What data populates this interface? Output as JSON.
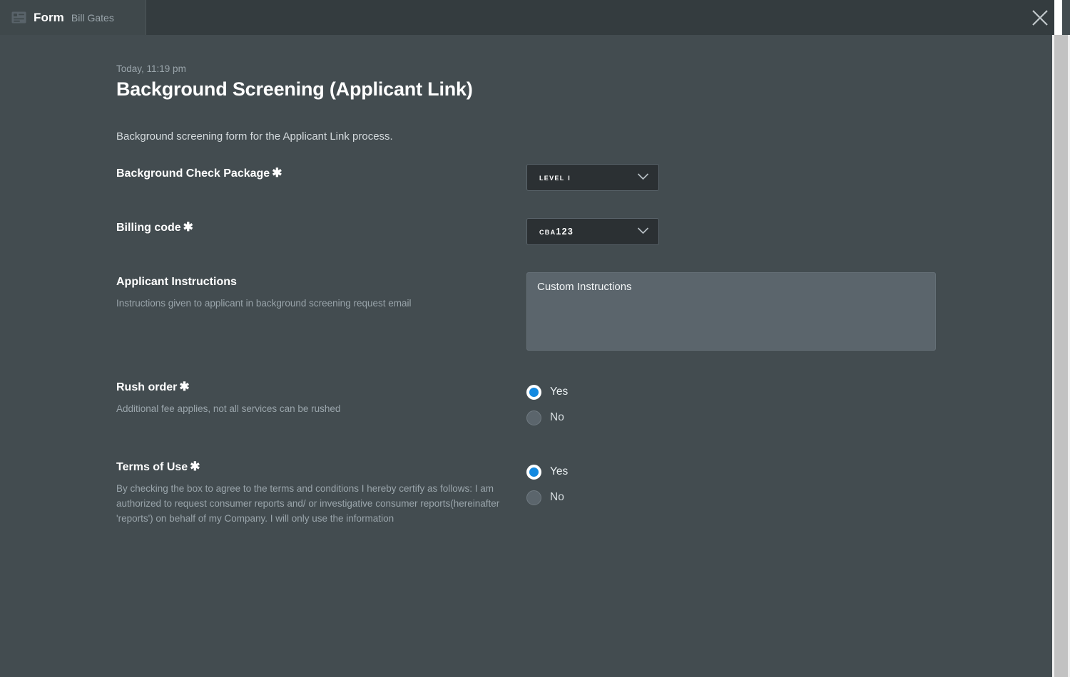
{
  "header": {
    "icon": "form-icon",
    "tab_title": "Form",
    "tab_subtitle": "Bill Gates",
    "close_icon": "close-icon"
  },
  "page": {
    "timestamp": "Today, 11:19 pm",
    "title": "Background Screening (Applicant Link)",
    "description": "Background screening form for the Applicant Link process."
  },
  "colors": {
    "background": "#434c50",
    "header": "#343c3f",
    "tab": "#3f484b",
    "dropdown": "#2b3033",
    "textarea": "#5b656c",
    "accent_blue": "#1389e0",
    "muted_text": "#9aa5ab",
    "scrollbar_thumb": "#c2c2c2"
  },
  "fields": [
    {
      "id": "background-check-package",
      "label": "Background Check Package",
      "required": true,
      "required_mark": "✱",
      "help": "",
      "control": "dropdown",
      "value": "LEVEL I",
      "chevron_icon": "chevron-down-icon"
    },
    {
      "id": "billing-code",
      "label": "Billing code",
      "required": true,
      "required_mark": "✱",
      "help": "",
      "control": "dropdown",
      "value": "CBA123",
      "chevron_icon": "chevron-down-icon"
    },
    {
      "id": "applicant-instructions",
      "label": "Applicant Instructions",
      "required": false,
      "required_mark": "",
      "help": "Instructions given to applicant in background screening request email",
      "control": "textarea",
      "value": "Custom Instructions"
    },
    {
      "id": "rush-order",
      "label": "Rush order",
      "required": true,
      "required_mark": "✱",
      "help": "Additional fee applies, not all services can be rushed",
      "control": "radio",
      "options": [
        {
          "label": "Yes",
          "selected": true
        },
        {
          "label": "No",
          "selected": false
        }
      ]
    },
    {
      "id": "terms-of-use",
      "label": "Terms of Use",
      "required": true,
      "required_mark": "✱",
      "help": "By checking the box to agree to the terms and conditions I hereby certify as follows: I am authorized to request consumer reports and/ or investigative consumer reports(hereinafter 'reports') on behalf of my Company. I will only use the information",
      "control": "radio",
      "options": [
        {
          "label": "Yes",
          "selected": true
        },
        {
          "label": "No",
          "selected": false
        }
      ]
    }
  ]
}
